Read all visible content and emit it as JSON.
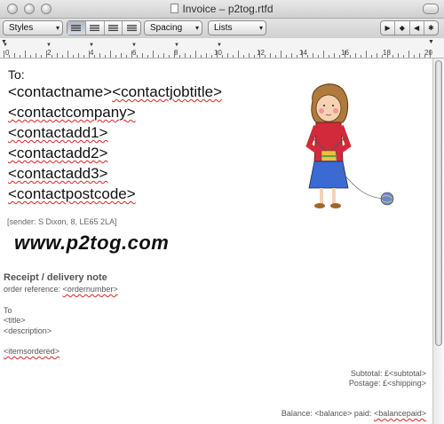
{
  "window": {
    "title": "Invoice – p2tog.rtfd"
  },
  "toolbar": {
    "styles_label": "Styles",
    "spacing_label": "Spacing",
    "lists_label": "Lists"
  },
  "ruler": {
    "numbers": [
      "0",
      "2",
      "4",
      "6",
      "8",
      "10",
      "12",
      "14",
      "16",
      "18",
      "20"
    ]
  },
  "document": {
    "to_label": "To:",
    "contactname": "<contactname>",
    "contactjobtitle": "<contactjobtitle>",
    "contactcompany": "<contactcompany>",
    "contactadd1": "<contactadd1>",
    "contactadd2": "<contactadd2>",
    "contactadd3": "<contactadd3>",
    "contactpostcode": "<contactpostcode>",
    "sender": "[sender: S Dixon, 8, LE65 2LA]",
    "brand": "www.p2tog.com",
    "receipt_heading": "Receipt / delivery note",
    "order_label": "order reference:",
    "ordernumber": "<ordernumber>",
    "to_small": "To",
    "title_field": "<title>",
    "description_field": "<description>",
    "itemsordered": "<itemsordered>",
    "subtotal_line": "Subtotal: £<subtotal>",
    "postage_line": "Postage: £<shipping>",
    "balance_text": "Balance: <balance> paid:",
    "balancepaid": "<balancepaid>"
  }
}
